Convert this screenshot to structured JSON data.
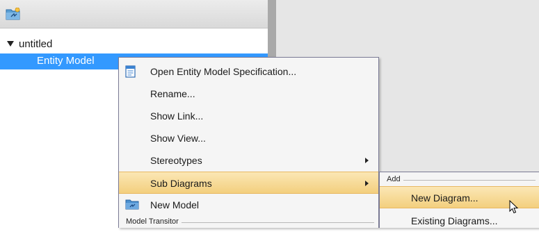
{
  "tree": {
    "root_label": "untitled",
    "selected_label": "Entity Model"
  },
  "context_menu": {
    "items": [
      {
        "label": "Open Entity Model Specification...",
        "icon": "specification-icon"
      },
      {
        "label": "Rename..."
      },
      {
        "label": "Show Link..."
      },
      {
        "label": "Show View..."
      },
      {
        "label": "Stereotypes",
        "has_submenu": true
      },
      {
        "label": "Sub Diagrams",
        "has_submenu": true,
        "highlighted": true
      },
      {
        "label": "New Model",
        "icon": "model-icon"
      }
    ],
    "group_header": "Model Transitor"
  },
  "submenu": {
    "group_header": "Add",
    "items": [
      {
        "label": "New Diagram...",
        "highlighted": true
      },
      {
        "label": "Existing Diagrams..."
      }
    ]
  },
  "colors": {
    "selection": "#3399ff",
    "highlight": "#f3cf7e",
    "menu_border": "#7a7a95"
  }
}
